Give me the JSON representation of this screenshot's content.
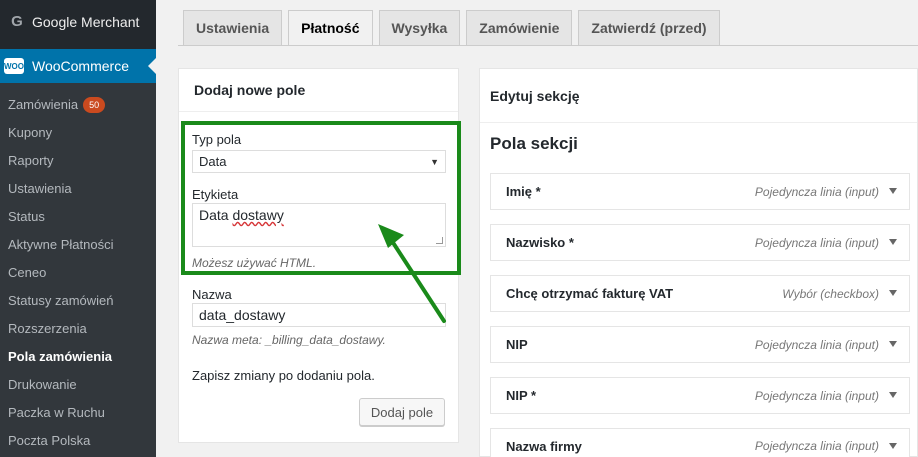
{
  "sidebar": {
    "top_item": "Google Merchant",
    "current": "WooCommerce",
    "current_icon": "WOO",
    "items": [
      {
        "label": "Zamówienia",
        "badge": "50"
      },
      {
        "label": "Kupony"
      },
      {
        "label": "Raporty"
      },
      {
        "label": "Ustawienia"
      },
      {
        "label": "Status"
      },
      {
        "label": "Aktywne Płatności"
      },
      {
        "label": "Ceneo"
      },
      {
        "label": "Statusy zamówień"
      },
      {
        "label": "Rozszerzenia"
      },
      {
        "label": "Pola zamówienia",
        "active": true
      },
      {
        "label": "Drukowanie"
      },
      {
        "label": "Paczka w Ruchu"
      },
      {
        "label": "Poczta Polska"
      }
    ]
  },
  "tabs": [
    "Ustawienia",
    "Płatność",
    "Wysyłka",
    "Zamówienie",
    "Zatwierdź (przed)"
  ],
  "active_tab": "Płatność",
  "add_field": {
    "heading": "Dodaj nowe pole",
    "type_label": "Typ pola",
    "type_value": "Data",
    "label_label": "Etykieta",
    "label_value_plain": "Data ",
    "label_value_spell": "dostawy",
    "label_hint": "Możesz używać HTML.",
    "name_label": "Nazwa",
    "name_value": "data_dostawy",
    "name_hint": "Nazwa meta: _billing_data_dostawy.",
    "save_note": "Zapisz zmiany po dodaniu pola.",
    "add_button": "Dodaj pole"
  },
  "edit_section": {
    "heading": "Edytuj sekcję",
    "title": "Pola sekcji",
    "fields": [
      {
        "name": "Imię *",
        "type": "Pojedyncza linia (input)"
      },
      {
        "name": "Nazwisko *",
        "type": "Pojedyncza linia (input)"
      },
      {
        "name": "Chcę otrzymać fakturę VAT",
        "type": "Wybór (checkbox)"
      },
      {
        "name": "NIP",
        "type": "Pojedyncza linia (input)"
      },
      {
        "name": "NIP *",
        "type": "Pojedyncza linia (input)"
      },
      {
        "name": "Nazwa firmy",
        "type": "Pojedyncza linia (input)"
      }
    ]
  },
  "colors": {
    "sidebar_bg": "#23282d",
    "sidebar_sub_bg": "#32373c",
    "current_bg": "#0073aa",
    "badge": "#ca4a1f",
    "highlight": "#1a8a1a"
  }
}
